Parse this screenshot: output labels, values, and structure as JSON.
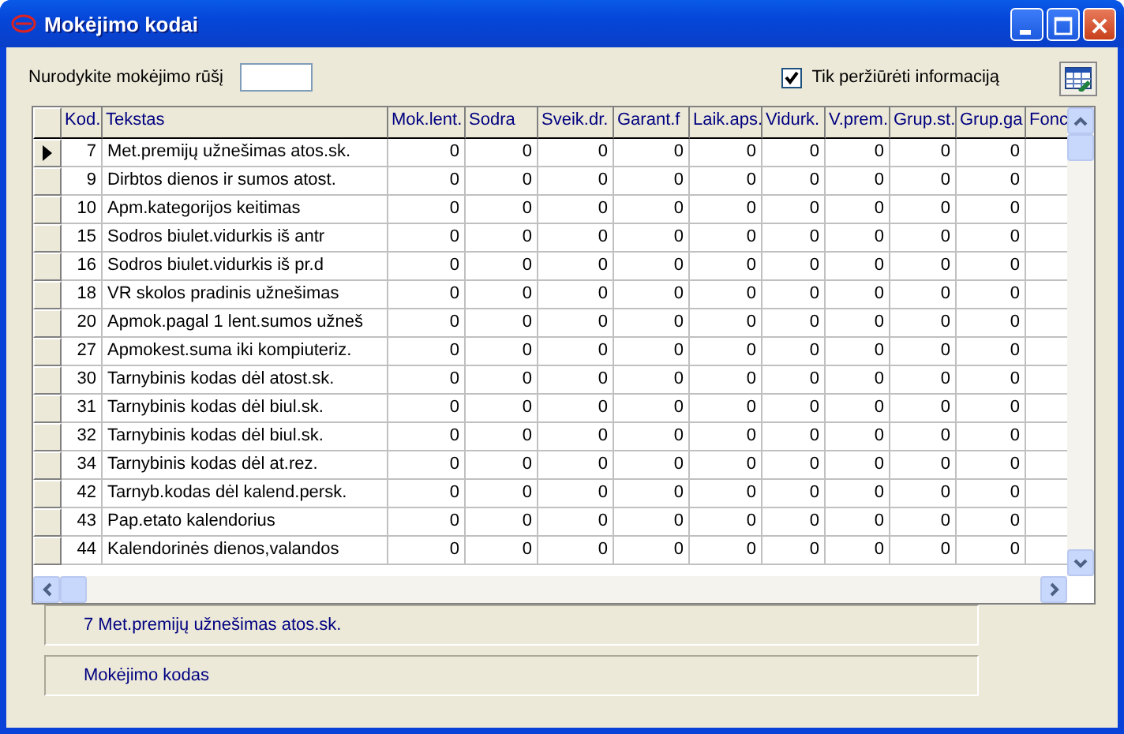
{
  "window": {
    "title": "Mokėjimo kodai"
  },
  "filter": {
    "label": "Nurodykite mokėjimo rūšį"
  },
  "view_only": {
    "label": "Tik peržiūrėti informaciją",
    "checked": true
  },
  "table": {
    "columns": [
      "Kod.",
      "Tekstas",
      "Mok.lent.",
      "Sodra",
      "Sveik.dr.",
      "Garant.f",
      "Laik.aps.",
      "Vidurk.",
      "V.prem.",
      "Grup.st.",
      "Grup.ga",
      "Fonc"
    ],
    "rows": [
      {
        "current": true,
        "cells": [
          "7",
          "Met.premijų užnešimas atos.sk.",
          "0",
          "0",
          "0",
          "0",
          "0",
          "0",
          "0",
          "0",
          "0"
        ]
      },
      {
        "current": false,
        "cells": [
          "9",
          "Dirbtos dienos ir sumos atost.",
          "0",
          "0",
          "0",
          "0",
          "0",
          "0",
          "0",
          "0",
          "0"
        ]
      },
      {
        "current": false,
        "cells": [
          "10",
          "Apm.kategorijos keitimas",
          "0",
          "0",
          "0",
          "0",
          "0",
          "0",
          "0",
          "0",
          "0"
        ]
      },
      {
        "current": false,
        "cells": [
          "15",
          "Sodros biulet.vidurkis iš antr",
          "0",
          "0",
          "0",
          "0",
          "0",
          "0",
          "0",
          "0",
          "0"
        ]
      },
      {
        "current": false,
        "cells": [
          "16",
          "Sodros biulet.vidurkis iš pr.d",
          "0",
          "0",
          "0",
          "0",
          "0",
          "0",
          "0",
          "0",
          "0"
        ]
      },
      {
        "current": false,
        "cells": [
          "18",
          "VR skolos pradinis užnešimas",
          "0",
          "0",
          "0",
          "0",
          "0",
          "0",
          "0",
          "0",
          "0"
        ]
      },
      {
        "current": false,
        "cells": [
          "20",
          "Apmok.pagal 1 lent.sumos užneš",
          "0",
          "0",
          "0",
          "0",
          "0",
          "0",
          "0",
          "0",
          "0"
        ]
      },
      {
        "current": false,
        "cells": [
          "27",
          "Apmokest.suma iki kompiuteriz.",
          "0",
          "0",
          "0",
          "0",
          "0",
          "0",
          "0",
          "0",
          "0"
        ]
      },
      {
        "current": false,
        "cells": [
          "30",
          "Tarnybinis kodas dėl atost.sk.",
          "0",
          "0",
          "0",
          "0",
          "0",
          "0",
          "0",
          "0",
          "0"
        ]
      },
      {
        "current": false,
        "cells": [
          "31",
          "Tarnybinis kodas dėl biul.sk.",
          "0",
          "0",
          "0",
          "0",
          "0",
          "0",
          "0",
          "0",
          "0"
        ]
      },
      {
        "current": false,
        "cells": [
          "32",
          "Tarnybinis kodas dėl biul.sk.",
          "0",
          "0",
          "0",
          "0",
          "0",
          "0",
          "0",
          "0",
          "0"
        ]
      },
      {
        "current": false,
        "cells": [
          "34",
          "Tarnybinis kodas dėl at.rez.",
          "0",
          "0",
          "0",
          "0",
          "0",
          "0",
          "0",
          "0",
          "0"
        ]
      },
      {
        "current": false,
        "cells": [
          "42",
          "Tarnyb.kodas dėl kalend.persk.",
          "0",
          "0",
          "0",
          "0",
          "0",
          "0",
          "0",
          "0",
          "0"
        ]
      },
      {
        "current": false,
        "cells": [
          "43",
          "Pap.etato kalendorius",
          "0",
          "0",
          "0",
          "0",
          "0",
          "0",
          "0",
          "0",
          "0"
        ]
      },
      {
        "current": false,
        "cells": [
          "44",
          "Kalendorinės dienos,valandos",
          "0",
          "0",
          "0",
          "0",
          "0",
          "0",
          "0",
          "0",
          "0"
        ]
      }
    ]
  },
  "status_lines": [
    "7 Met.premijų užnešimas atos.sk.",
    "Mokėjimo kodas"
  ]
}
